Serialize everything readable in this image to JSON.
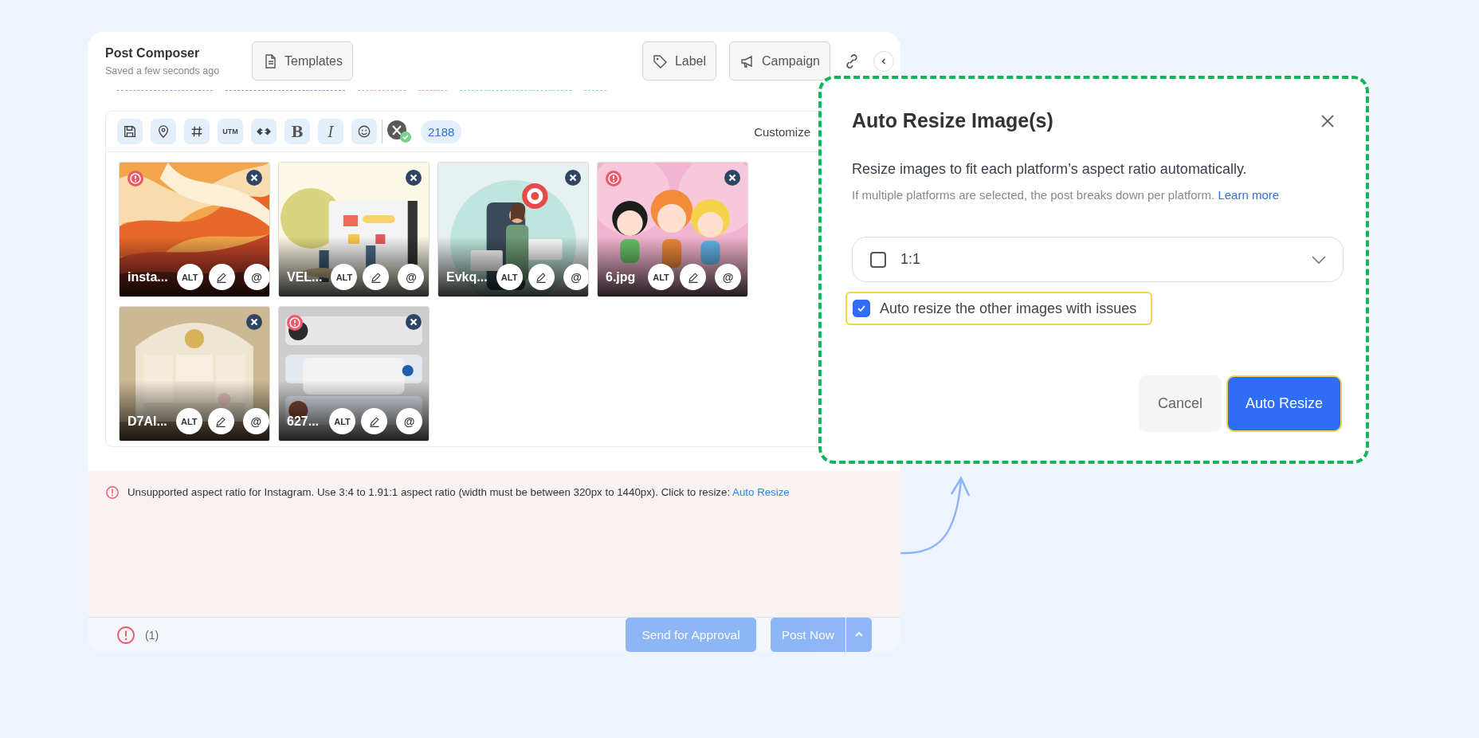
{
  "header": {
    "title": "Post Composer",
    "saved": "Saved a few seconds ago",
    "buttons": [
      {
        "kind": "templates",
        "label": "Templates"
      },
      {
        "kind": "label",
        "label": "Label"
      },
      {
        "kind": "campaign",
        "label": "Campaign"
      }
    ]
  },
  "chip_edges": [
    {
      "color": "#b48cf2"
    },
    {
      "color": "#6f9ae8"
    },
    {
      "color": "#f39ac4"
    },
    {
      "color": "#f39ac4"
    },
    {
      "color": "#86dcae"
    },
    {
      "color": "#86dcae"
    }
  ],
  "toolbar": {
    "tools": [
      {
        "kind": "save"
      },
      {
        "kind": "location"
      },
      {
        "kind": "hashtag"
      },
      {
        "kind": "utm",
        "label": "UTM"
      },
      {
        "kind": "link"
      },
      {
        "kind": "bold",
        "label": "B"
      },
      {
        "kind": "italic",
        "label": "I"
      },
      {
        "kind": "emoji"
      }
    ],
    "count": "2188",
    "customize": "Customize"
  },
  "images": [
    {
      "name": "insta...",
      "error": true,
      "alt": "ALT",
      "mention": "@"
    },
    {
      "name": "VEL...",
      "error": false,
      "alt": "ALT",
      "mention": "@"
    },
    {
      "name": "Evkq...",
      "error": false,
      "alt": "ALT",
      "mention": "@"
    },
    {
      "name": "6.jpg",
      "error": true,
      "alt": "ALT",
      "mention": "@"
    },
    {
      "name": "D7AI...",
      "error": false,
      "alt": "ALT",
      "mention": "@"
    },
    {
      "name": "627...",
      "error": true,
      "alt": "ALT",
      "mention": "@"
    }
  ],
  "error_banner": {
    "message": "Unsupported aspect ratio for Instagram. Use 3:4 to 1.91:1 aspect ratio (width must be between 320px to 1440px). Click to resize:",
    "link": "Auto Resize"
  },
  "footer": {
    "issues": "(1)",
    "send": {
      "label": "Send for Approval",
      "disabled": true
    },
    "post": {
      "label": "Post Now",
      "disabled": true
    }
  },
  "dialog": {
    "title": "Auto Resize Image(s)",
    "description": "Resize images to fit each platform’s aspect ratio automatically.",
    "hint": "If multiple platforms are selected, the post breaks down per platform.",
    "hint_link": "Learn more",
    "ratio": {
      "label": "1:1",
      "checked": false
    },
    "auto_resize_others": {
      "label": "Auto resize the other images with issues",
      "checked": true,
      "highlighted": true
    },
    "buttons": [
      {
        "kind": "secondary",
        "label": "Cancel",
        "highlighted": false
      },
      {
        "kind": "primary",
        "label": "Auto Resize",
        "highlighted": true
      }
    ]
  }
}
